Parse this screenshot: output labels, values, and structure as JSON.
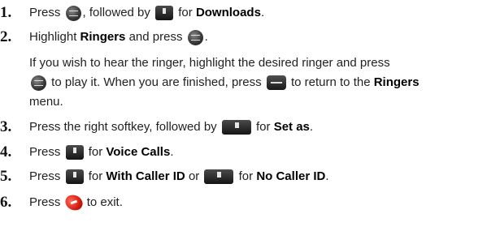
{
  "steps": [
    {
      "num": "1.",
      "pre": "Press",
      "mid": ", followed by",
      "post": "for",
      "bold": "Downloads",
      "end": ".",
      "icons": [
        "menu-ok-key-icon",
        "7-pqrs-key-icon"
      ]
    },
    {
      "num": "2.",
      "pre": "Highlight",
      "bold": "Ringers",
      "mid": "and press",
      "end": ".",
      "icons": [
        "menu-ok-key-icon"
      ]
    },
    {
      "num": "3.",
      "pre": "Press the right softkey, followed by",
      "post": "for",
      "bold": "Set as",
      "end": ".",
      "icons": [
        "2-abc-key-icon"
      ]
    },
    {
      "num": "4.",
      "pre": "Press",
      "post": "for",
      "bold": "Voice Calls",
      "end": ".",
      "icons": [
        "1-key-icon"
      ]
    },
    {
      "num": "5.",
      "pre": "Press",
      "post": "for",
      "bold": "With Caller ID",
      "mid": "or",
      "post2": "for",
      "bold2": "No Caller ID",
      "end": ".",
      "icons": [
        "1-key-icon",
        "2-abc-key-icon"
      ]
    },
    {
      "num": "6.",
      "pre": "Press",
      "post": "to exit.",
      "icons": [
        "end-key-icon"
      ]
    }
  ],
  "note": {
    "line1": "If you wish to hear the ringer, highlight the desired ringer and press",
    "play": "to play it. When you are finished, press",
    "ret": "to return to the",
    "bold": "Ringers",
    "line3": "menu."
  },
  "colors": {
    "text": "#222222",
    "end_key": "#d41a10"
  }
}
